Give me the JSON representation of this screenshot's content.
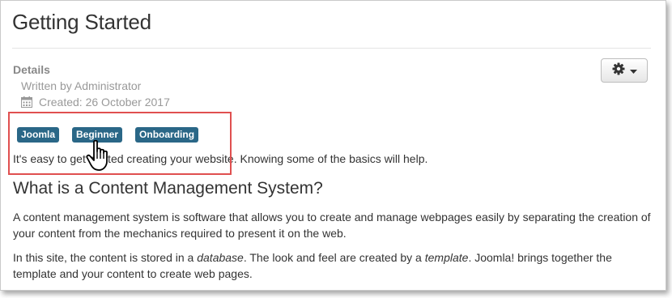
{
  "article": {
    "title": "Getting Started",
    "details_label": "Details",
    "written_by": "Written by Administrator",
    "created": "Created: 26 October 2017",
    "tags": [
      {
        "label": "Joomla"
      },
      {
        "label": "Beginner"
      },
      {
        "label": "Onboarding"
      }
    ],
    "intro": "It's easy to get started creating your website. Knowing some of the basics will help.",
    "section_heading": "What is a Content Management System?",
    "paragraph1": "A content management system is software that allows you to create and manage webpages easily by separating the creation of your content from the mechanics required to present it on the web.",
    "paragraph2": {
      "part1": "In this site, the content is stored in a ",
      "em1": "database",
      "part2": ". The look and feel are created by a ",
      "em2": "template",
      "part3": ". Joomla! brings together the template and your content to create web pages."
    }
  },
  "toolbar": {
    "gear_icon": "gear-icon",
    "caret_icon": "caret-down-icon"
  },
  "annotation": {
    "highlight_color": "#e05050",
    "cursor_icon": "hand-pointer-icon"
  },
  "colors": {
    "tag_background": "#2a6787",
    "meta_text": "#999999"
  }
}
